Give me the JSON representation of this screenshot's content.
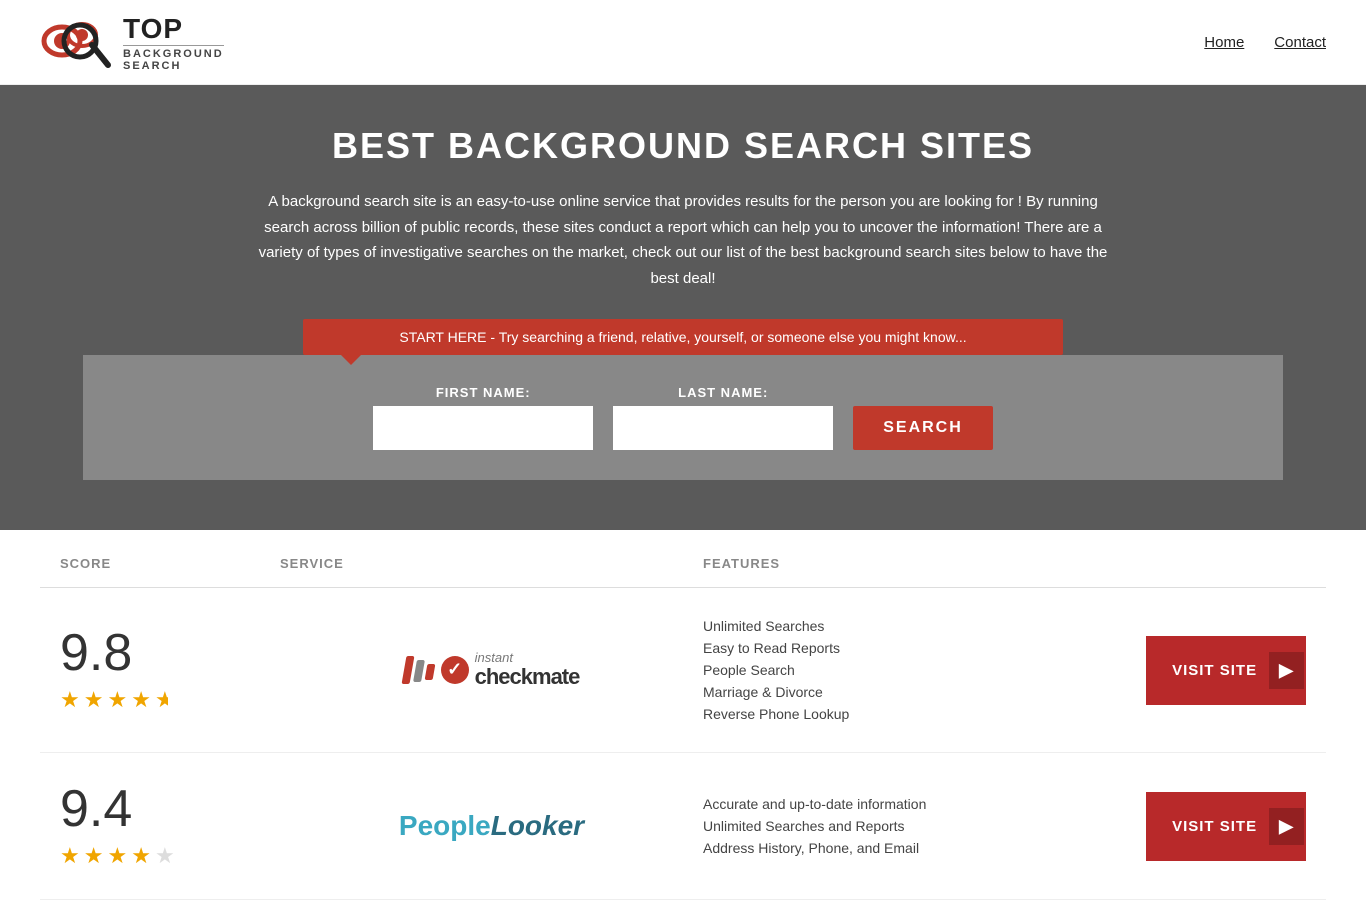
{
  "header": {
    "logo_top": "TOP",
    "logo_sub": "BACKGROUND\nSEARCH",
    "nav": {
      "home": "Home",
      "contact": "Contact"
    }
  },
  "hero": {
    "title": "BEST BACKGROUND SEARCH SITES",
    "description": "A background search site is an easy-to-use online service that provides results  for the person you are looking for ! By  running  search across billion of public records, these sites conduct  a report which can help you to uncover the information! There are a variety of types of investigative searches on the market, check out our  list of the best background search sites below to have the best deal!",
    "callout": "START HERE - Try searching a friend, relative, yourself, or someone else you might know..."
  },
  "search_form": {
    "first_name_label": "FIRST NAME:",
    "last_name_label": "LAST NAME:",
    "first_name_placeholder": "",
    "last_name_placeholder": "",
    "search_button": "SEARCH"
  },
  "table": {
    "headers": {
      "score": "SCORE",
      "service": "SERVICE",
      "features": "FEATURES",
      "action": ""
    },
    "rows": [
      {
        "score": "9.8",
        "stars": 4.5,
        "service_name": "Instant Checkmate",
        "service_type": "checkmate",
        "features": [
          "Unlimited Searches",
          "Easy to Read Reports",
          "People Search",
          "Marriage & Divorce",
          "Reverse Phone Lookup"
        ],
        "visit_btn": "VISIT SITE"
      },
      {
        "score": "9.4",
        "stars": 4,
        "service_name": "PeopleLooker",
        "service_type": "peoplelooker",
        "features": [
          "Accurate and up-to-date information",
          "Unlimited Searches and Reports",
          "Address History, Phone, and Email"
        ],
        "visit_btn": "VISIT SITE"
      }
    ]
  }
}
